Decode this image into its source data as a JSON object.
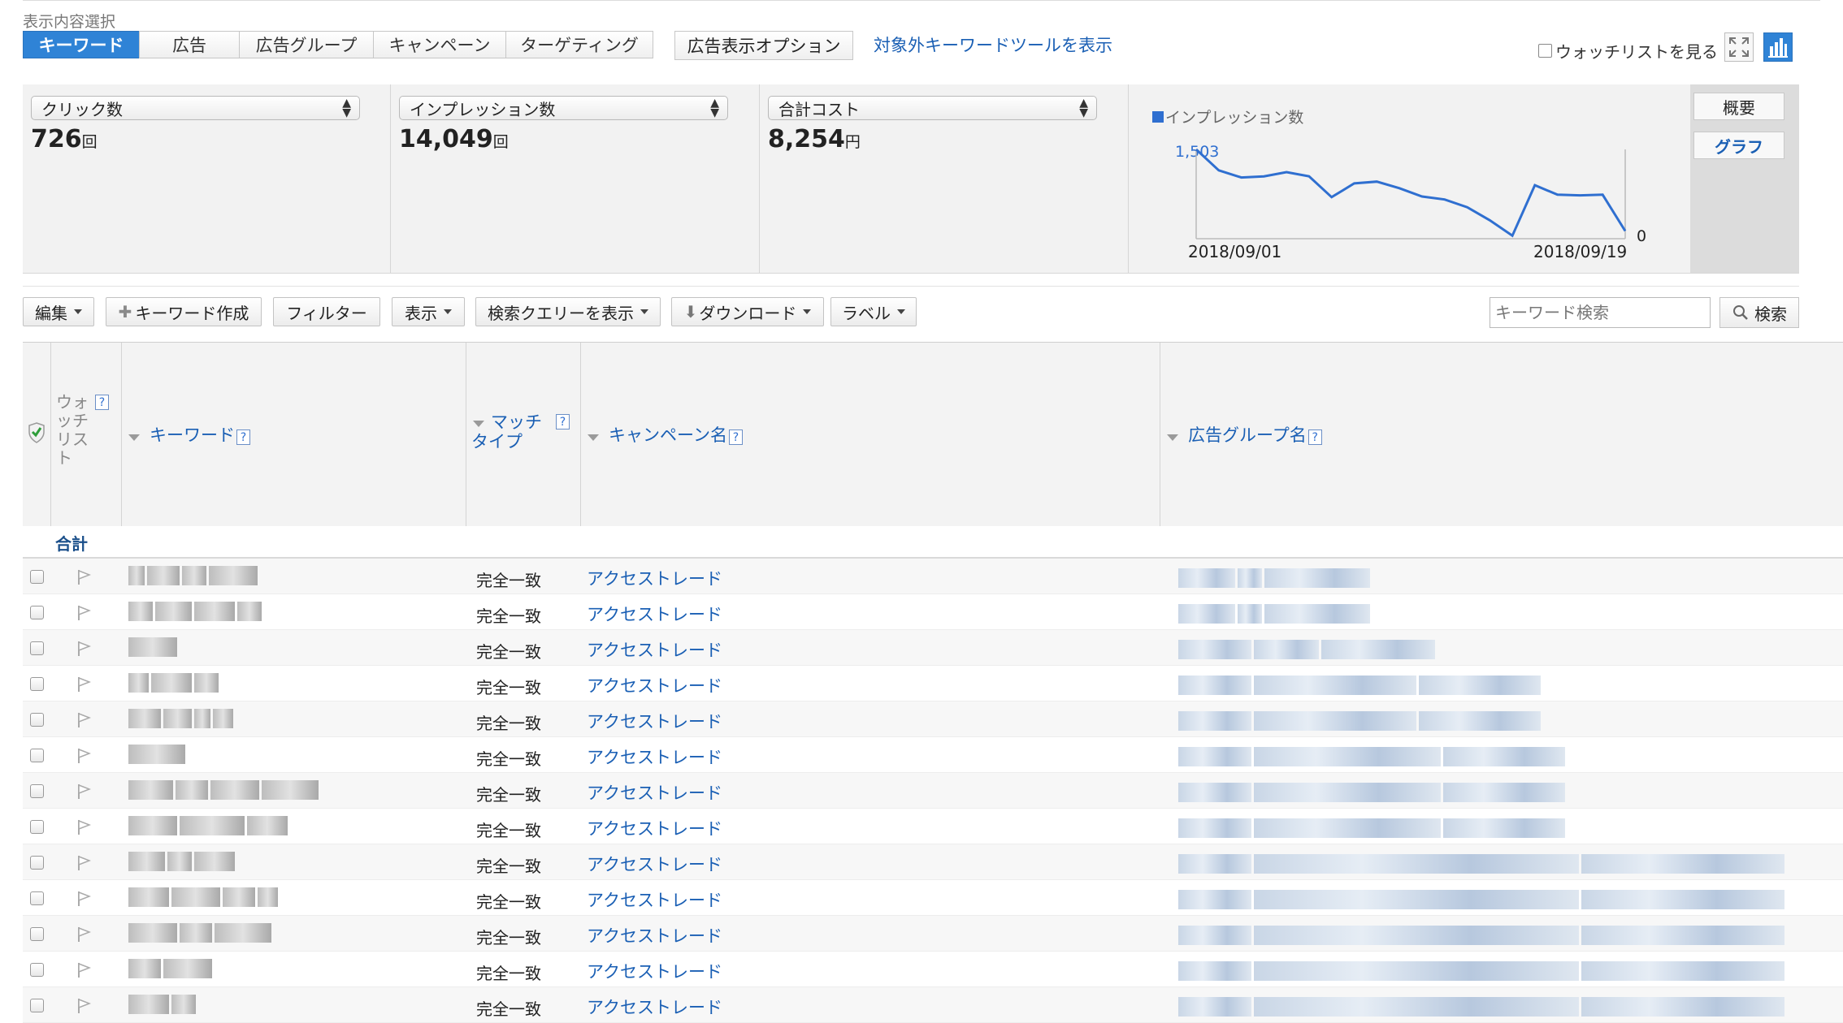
{
  "section_label": "表示内容選択",
  "tabs": [
    {
      "label": "キーワード",
      "active": true
    },
    {
      "label": "広告",
      "active": false
    },
    {
      "label": "広告グループ",
      "active": false
    },
    {
      "label": "キャンペーン",
      "active": false
    },
    {
      "label": "ターゲティング",
      "active": false
    }
  ],
  "ad_display_option": "広告表示オプション",
  "excluded_keyword_tool_link": "対象外キーワードツールを表示",
  "watchlist_toggle": "ウォッチリストを見る",
  "icons": {
    "fullscreen": "fullscreen-icon",
    "chart_toggle": "bar-chart-icon"
  },
  "metrics": [
    {
      "selector": "クリック数",
      "value": "726",
      "unit": "回"
    },
    {
      "selector": "インプレッション数",
      "value": "14,049",
      "unit": "回"
    },
    {
      "selector": "合計コスト",
      "value": "8,254",
      "unit": "円"
    }
  ],
  "graph": {
    "legend": "インプレッション数",
    "max_label": "1,503",
    "zero_label": "0",
    "start_date": "2018/09/01",
    "end_date": "2018/09/19"
  },
  "chart_data": {
    "type": "line",
    "series": [
      {
        "name": "インプレッション数",
        "values": [
          1503,
          1150,
          1030,
          1050,
          1120,
          1050,
          700,
          930,
          960,
          850,
          710,
          660,
          530,
          310,
          50,
          900,
          740,
          730,
          740,
          130
        ]
      }
    ],
    "ylim": [
      0,
      1503
    ],
    "x_start": "2018/09/01",
    "x_end": "2018/09/19",
    "grid": false
  },
  "side_buttons": {
    "summary": "概要",
    "graph": "グラフ"
  },
  "toolbar": {
    "edit": "編集",
    "create_keyword": "キーワード作成",
    "filter": "フィルター",
    "display": "表示",
    "search_query": "検索クエリーを表示",
    "download": "ダウンロード",
    "label": "ラベル",
    "search_placeholder": "キーワード検索",
    "search_button": "検索"
  },
  "table": {
    "headers": {
      "watchlist": "ウォッチリスト",
      "keyword": "キーワード",
      "match_type": "マッチタイプ",
      "campaign": "キャンペーン名",
      "ad_group": "広告グループ名"
    },
    "total_label": "合計",
    "rows": [
      {
        "match_type": "完全一致",
        "campaign": "アクセストレード"
      },
      {
        "match_type": "完全一致",
        "campaign": "アクセストレード"
      },
      {
        "match_type": "完全一致",
        "campaign": "アクセストレード"
      },
      {
        "match_type": "完全一致",
        "campaign": "アクセストレード"
      },
      {
        "match_type": "完全一致",
        "campaign": "アクセストレード"
      },
      {
        "match_type": "完全一致",
        "campaign": "アクセストレード"
      },
      {
        "match_type": "完全一致",
        "campaign": "アクセストレード"
      },
      {
        "match_type": "完全一致",
        "campaign": "アクセストレード"
      },
      {
        "match_type": "完全一致",
        "campaign": "アクセストレード"
      },
      {
        "match_type": "完全一致",
        "campaign": "アクセストレード"
      },
      {
        "match_type": "完全一致",
        "campaign": "アクセストレード"
      },
      {
        "match_type": "完全一致",
        "campaign": "アクセストレード"
      },
      {
        "match_type": "完全一致",
        "campaign": "アクセストレード"
      }
    ]
  },
  "colors": {
    "accent": "#2f83d6",
    "link": "#1a5fb4",
    "line": "#2f6fd0"
  }
}
